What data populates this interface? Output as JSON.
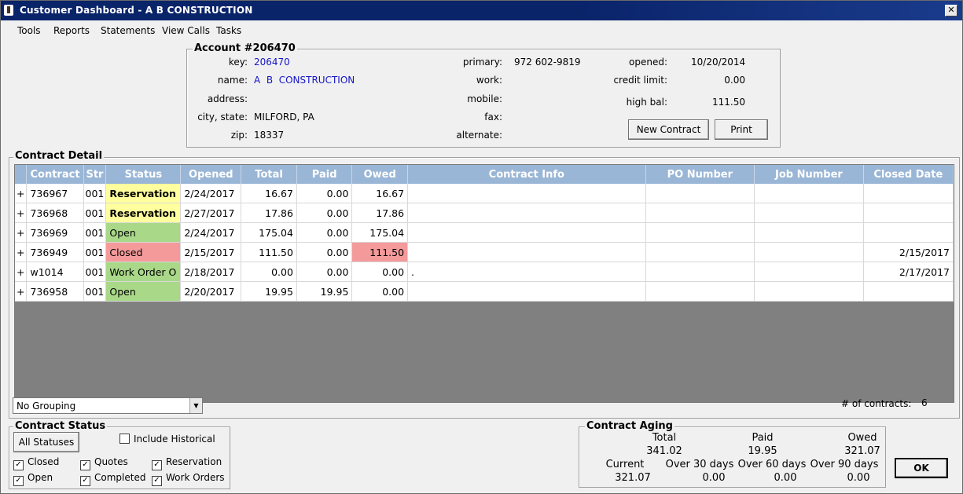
{
  "window": {
    "title": "Customer Dashboard - A  B  CONSTRUCTION",
    "close_label": "✕"
  },
  "menu": [
    "Tools",
    "Reports",
    "Statements",
    "View Calls",
    "Tasks"
  ],
  "account": {
    "header": "Account #206470",
    "key_label": "key:",
    "key": "206470",
    "name_label": "name:",
    "name": "A  B  CONSTRUCTION",
    "address_label": "address:",
    "address": "",
    "city_label": "city, state:",
    "city": "MILFORD, PA",
    "zip_label": "zip:",
    "zip": "18337",
    "primary_label": "primary:",
    "primary": "972 602-9819",
    "work_label": "work:",
    "mobile_label": "mobile:",
    "fax_label": "fax:",
    "alternate_label": "alternate:",
    "opened_label": "opened:",
    "opened": "10/20/2014",
    "credit_label": "credit limit:",
    "credit": "0.00",
    "highbal_label": "high bal:",
    "highbal": "111.50",
    "new_contract": "New Contract",
    "print": "Print"
  },
  "contract_detail": {
    "header": "Contract Detail",
    "columns": [
      "Contract",
      "Str",
      "Status",
      "Opened",
      "Total",
      "Paid",
      "Owed",
      "Contract Info",
      "PO Number",
      "Job Number",
      "Closed Date"
    ],
    "rows": [
      {
        "expand": "+",
        "contract": "736967",
        "str": "001",
        "status": "Reservation",
        "opened": "2/24/2017",
        "total": "16.67",
        "paid": "0.00",
        "owed": "16.67",
        "info": "",
        "po": "",
        "job": "",
        "closed": ""
      },
      {
        "expand": "+",
        "contract": "736968",
        "str": "001",
        "status": "Reservation",
        "opened": "2/27/2017",
        "total": "17.86",
        "paid": "0.00",
        "owed": "17.86",
        "info": "",
        "po": "",
        "job": "",
        "closed": ""
      },
      {
        "expand": "+",
        "contract": "736969",
        "str": "001",
        "status": "Open",
        "opened": "2/24/2017",
        "total": "175.04",
        "paid": "0.00",
        "owed": "175.04",
        "info": "",
        "po": "",
        "job": "",
        "closed": ""
      },
      {
        "expand": "+",
        "contract": "736949",
        "str": "001",
        "status": "Closed",
        "opened": "2/15/2017",
        "total": "111.50",
        "paid": "0.00",
        "owed": "111.50",
        "info": "",
        "po": "",
        "job": "",
        "closed": "2/15/2017"
      },
      {
        "expand": "+",
        "contract": "w1014",
        "str": "001",
        "status": "Work Order O",
        "opened": "2/18/2017",
        "total": "0.00",
        "paid": "0.00",
        "owed": "0.00",
        "info": ".",
        "po": "",
        "job": "",
        "closed": "2/17/2017"
      },
      {
        "expand": "+",
        "contract": "736958",
        "str": "001",
        "status": "Open",
        "opened": "2/20/2017",
        "total": "19.95",
        "paid": "19.95",
        "owed": "0.00",
        "info": "",
        "po": "",
        "job": "",
        "closed": ""
      }
    ]
  },
  "grouping": {
    "selected": "No Grouping"
  },
  "contracts_count": {
    "label": "# of contracts:",
    "value": "6"
  },
  "contract_status": {
    "header": "Contract Status",
    "all_statuses": "All Statuses",
    "include_historical": "Include Historical",
    "closed": "Closed",
    "open": "Open",
    "quotes": "Quotes",
    "completed": "Completed",
    "reservation": "Reservation",
    "work_orders": "Work Orders"
  },
  "aging": {
    "header": "Contract Aging",
    "total_label": "Total",
    "total": "341.02",
    "paid_label": "Paid",
    "paid": "19.95",
    "owed_label": "Owed",
    "owed": "321.07",
    "current_label": "Current",
    "current": "321.07",
    "over30_label": "Over 30 days",
    "over30": "0.00",
    "over60_label": "Over 60 days",
    "over60": "0.00",
    "over90_label": "Over 90 days",
    "over90": "0.00"
  },
  "ok_label": "OK"
}
